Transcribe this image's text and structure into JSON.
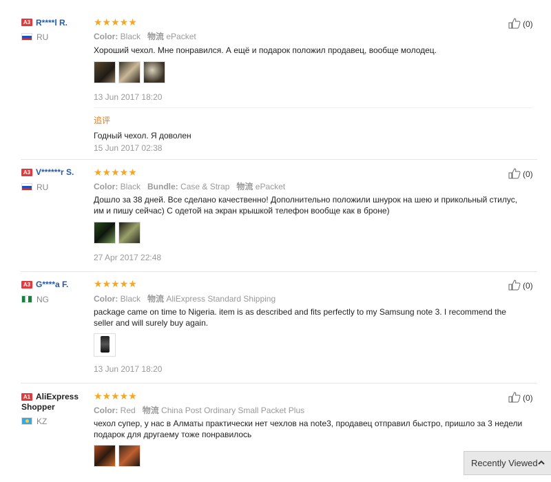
{
  "reviews": [
    {
      "badge": "A3",
      "user": "R****l R.",
      "country": "RU",
      "stars": "★★★★★",
      "attr_color_label": "Color:",
      "attr_color": "Black",
      "attr_ship_label": "物流",
      "attr_ship": "ePacket",
      "text": "Хороший чехол. Мне понравился. А ещё и подарок положил продавец, вообще молодец.",
      "date": "13 Jun 2017 18:20",
      "append_label": "追评",
      "append_text": "Годный чехол. Я доволен",
      "append_date": "15 Jun 2017 02:38",
      "helpful": "(0)"
    },
    {
      "badge": "A3",
      "user": "V******r S.",
      "country": "RU",
      "stars": "★★★★★",
      "attr_color_label": "Color:",
      "attr_color": "Black",
      "attr_bundle_label": "Bundle:",
      "attr_bundle": "Case & Strap",
      "attr_ship_label": "物流",
      "attr_ship": "ePacket",
      "text": "Дошло за 38 дней. Все сделано качественно! Дополнительно положили шнурок на шею и прикольный стилус, им и пишу сейчас) С одетой на экран крышкой телефон вообще как в броне)",
      "date": "27 Apr 2017 22:48",
      "helpful": "(0)"
    },
    {
      "badge": "A3",
      "user": "G****a F.",
      "country": "NG",
      "stars": "★★★★★",
      "attr_color_label": "Color:",
      "attr_color": "Black",
      "attr_ship_label": "物流",
      "attr_ship": "AliExpress Standard Shipping",
      "text": "package came on time to Nigeria. item is as described and fits perfectly to my Samsung note 3. I recommend the seller and will surely buy again.",
      "date": "13 Jun 2017 18:20",
      "helpful": "(0)"
    },
    {
      "badge": "A1",
      "user_line1": "AliExpress",
      "user_line2": "Shopper",
      "country": "KZ",
      "stars": "★★★★★",
      "attr_color_label": "Color:",
      "attr_color": "Red",
      "attr_ship_label": "物流",
      "attr_ship": "China Post Ordinary Small Packet Plus",
      "text": "чехол супер, у нас в Алматы практически нет чехлов на note3, продавец отправил быстро, пришло за 3 недели подарок для другаему тоже понравилось",
      "helpful": "(0)"
    }
  ],
  "recently_viewed": "Recently Viewed",
  "colors": {
    "accent_star": "#f5a623",
    "user_link": "#2358b0",
    "badge": "#e4393c",
    "append": "#e87c15"
  }
}
